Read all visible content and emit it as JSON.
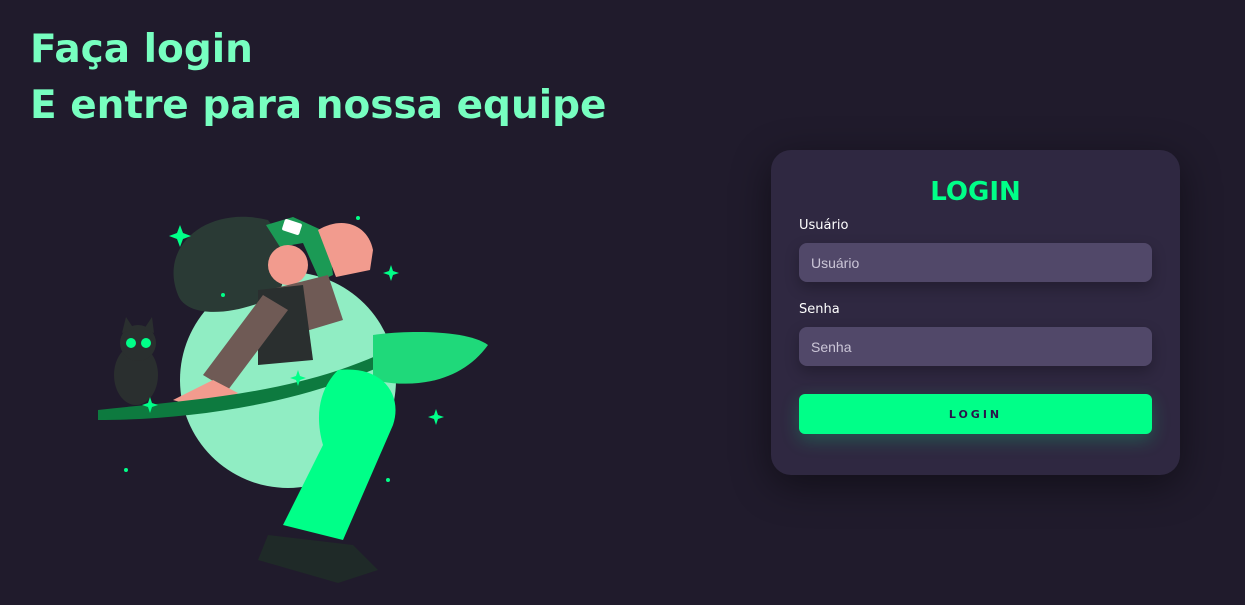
{
  "headline": {
    "line1": "Faça login",
    "line2": "E entre para nossa equipe"
  },
  "illustration": {
    "subject": "witch-on-broom-with-cat-illustration"
  },
  "login_card": {
    "title": "LOGIN",
    "username": {
      "label": "Usuário",
      "placeholder": "Usuário",
      "value": ""
    },
    "password": {
      "label": "Senha",
      "placeholder": "Senha",
      "value": ""
    },
    "submit_label": "LOGIN"
  },
  "colors": {
    "background": "#201b2c",
    "headline": "#77ffc0",
    "card": "#2f2841",
    "input": "#514869",
    "accent": "#00ff88"
  }
}
